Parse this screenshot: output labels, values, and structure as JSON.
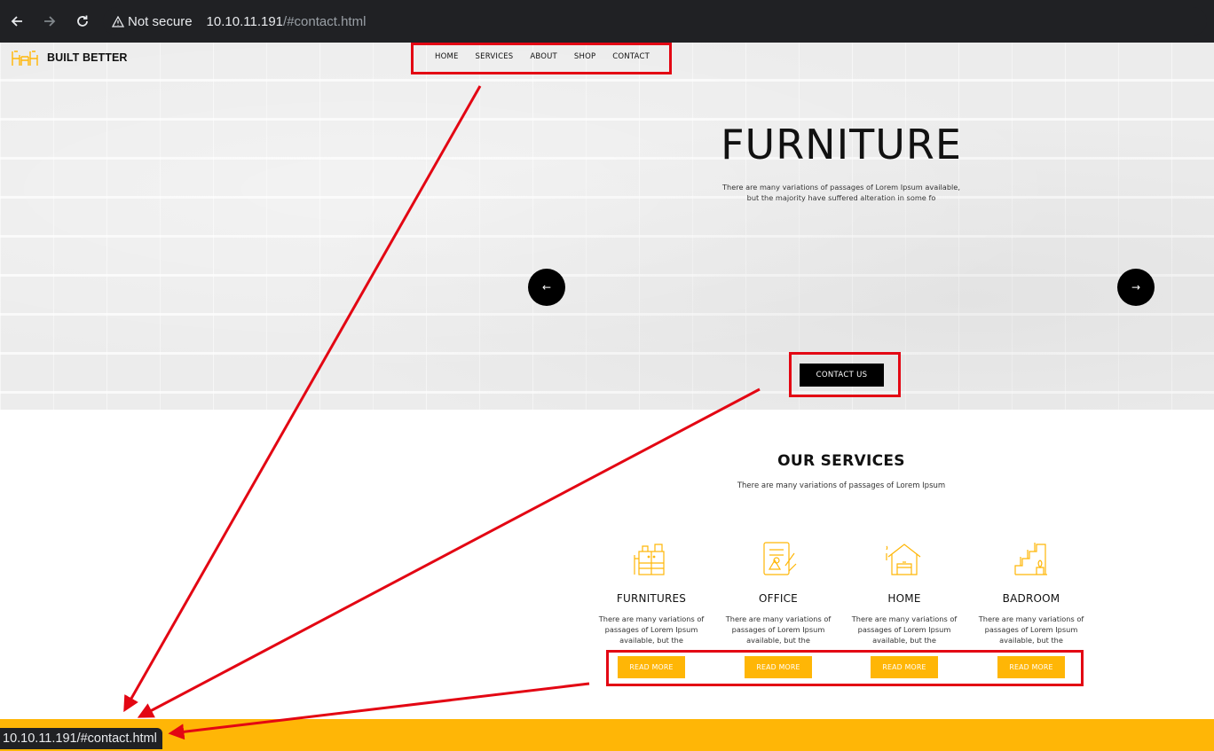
{
  "browser": {
    "security_label": "Not secure",
    "url_host": "10.10.11.191",
    "url_path": "/#contact.html"
  },
  "site": {
    "brand": "BUILT BETTER",
    "nav": [
      "HOME",
      "SERVICES",
      "ABOUT",
      "SHOP",
      "CONTACT"
    ],
    "hero": {
      "title": "FURNITURE",
      "subtitle": "There are many variations of passages of Lorem Ipsum available, but the majority have suffered alteration in some fo",
      "prev_arrow": "←",
      "next_arrow": "→",
      "cta": "CONTACT US"
    },
    "services": {
      "title": "OUR SERVICES",
      "subtitle": "There are many variations of passages of Lorem Ipsum",
      "items": [
        {
          "name": "FURNITURES",
          "icon": "cabinet-icon",
          "desc": "There are many variations of passages of Lorem Ipsum available, but the",
          "button": "READ MORE"
        },
        {
          "name": "OFFICE",
          "icon": "office-blueprint-icon",
          "desc": "There are many variations of passages of Lorem Ipsum available, but the",
          "button": "READ MORE"
        },
        {
          "name": "HOME",
          "icon": "house-icon",
          "desc": "There are many variations of passages of Lorem Ipsum available, but the",
          "button": "READ MORE"
        },
        {
          "name": "BADROOM",
          "icon": "stairs-plant-icon",
          "desc": "There are many variations of passages of Lorem Ipsum available, but the",
          "button": "READ MORE"
        }
      ]
    }
  },
  "status_bar": {
    "hover_url": "10.10.11.191/#contact.html"
  },
  "colors": {
    "accent": "#ffb606",
    "annotation": "#e30613",
    "chrome_bg": "#202124"
  }
}
